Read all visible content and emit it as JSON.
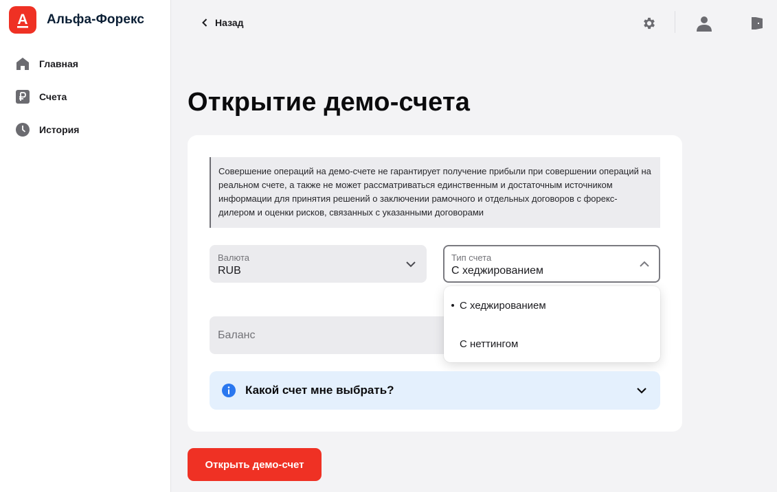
{
  "brand": {
    "name": "Альфа-Форекс",
    "logo_letter": "А",
    "accent": "#ef3124"
  },
  "sidebar": {
    "items": [
      {
        "label": "Главная",
        "icon": "home-icon"
      },
      {
        "label": "Счета",
        "icon": "ruble-icon"
      },
      {
        "label": "История",
        "icon": "clock-icon"
      }
    ]
  },
  "topbar": {
    "back_label": "Назад",
    "icons": [
      "gear-icon",
      "user-icon",
      "logout-icon"
    ]
  },
  "page": {
    "title": "Открытие демо-счета"
  },
  "notice": {
    "text": "Совершение операций на демо-счете не гарантирует получение прибыли при совершении операций на реальном счете, а также не может рассматриваться единственным и достаточным источником информации для принятия решений о заключении рамочного и отдельных договоров с форекс-дилером и оценки рисков, связанных с указанными договорами"
  },
  "form": {
    "currency": {
      "label": "Валюта",
      "value": "RUB"
    },
    "account_type": {
      "label": "Тип счета",
      "value": "С хеджированием",
      "options": [
        "С хеджированием",
        "С неттингом"
      ],
      "selected_index": 0,
      "open": true
    },
    "balance": {
      "placeholder": "Баланс"
    }
  },
  "accordion": {
    "title": "Какой счет мне выбрать?",
    "icon": "info-icon",
    "accent": "#2a77ef"
  },
  "submit": {
    "label": "Открыть демо-счет"
  }
}
